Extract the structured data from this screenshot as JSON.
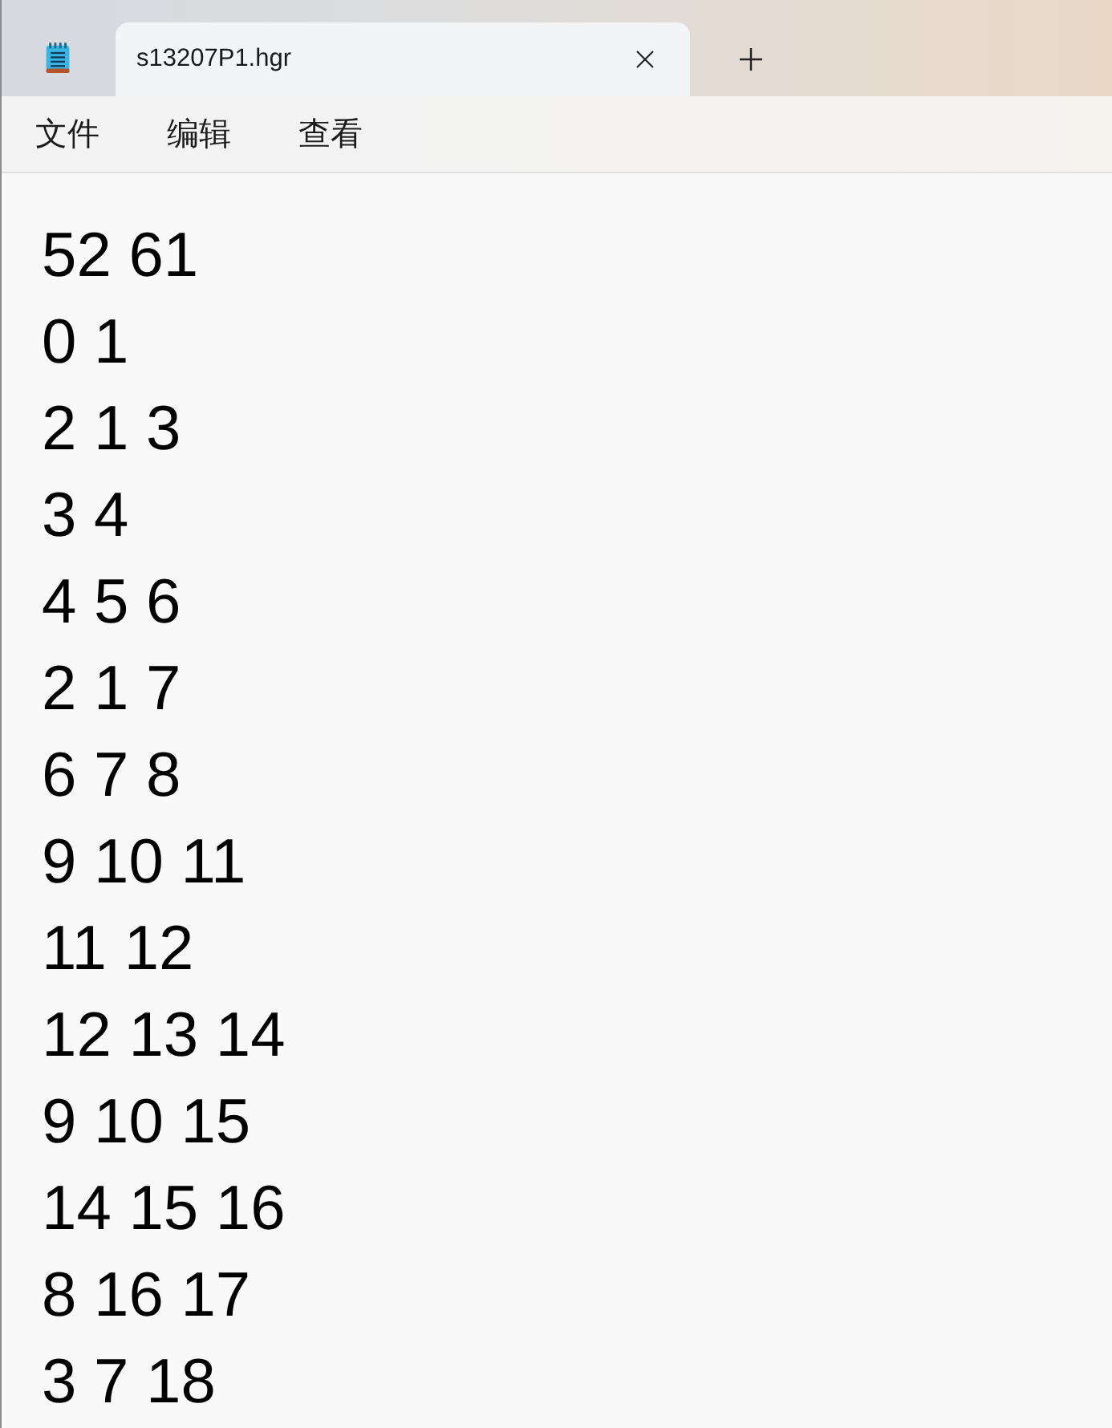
{
  "tabs": [
    {
      "title": "s13207P1.hgr",
      "selected": true
    }
  ],
  "menu": [
    "文件",
    "编辑",
    "查看"
  ],
  "lines": [
    "52 61",
    "0 1",
    "2 1 3",
    "3 4",
    "4 5 6",
    "2 1 7",
    "6 7 8",
    "9 10 11",
    "11 12",
    "12 13 14",
    "9 10 15",
    "14 15 16",
    "8 16 17",
    "3 7 18"
  ]
}
